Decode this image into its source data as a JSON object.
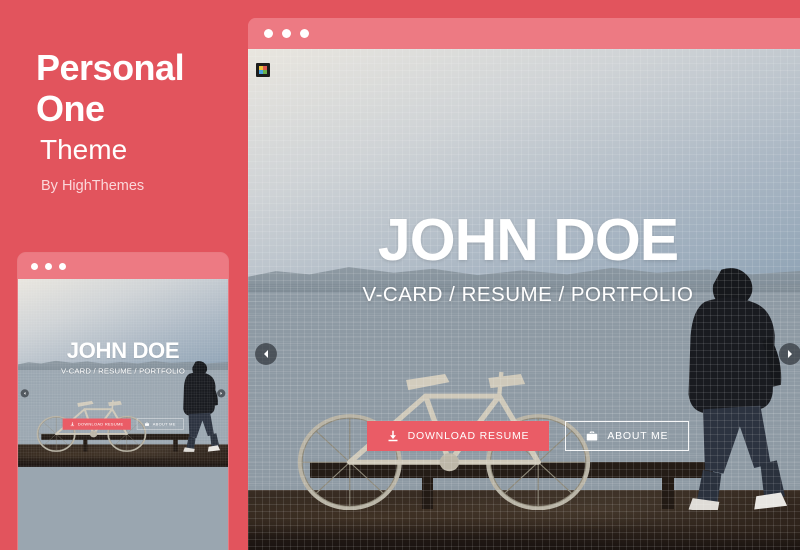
{
  "page": {
    "background_color": "#e2545d",
    "chrome_color": "#ed7a83"
  },
  "left_panel": {
    "title": "Personal One",
    "subtitle": "Theme",
    "author": "By HighThemes"
  },
  "browser_window": {
    "name": "main-browser-preview",
    "dots": [
      "dot-1",
      "dot-2",
      "dot-3"
    ]
  },
  "mobile_window": {
    "name": "mobile-browser-preview",
    "dots": [
      "dot-1",
      "dot-2",
      "dot-3"
    ]
  },
  "hero": {
    "logo_icon": "site-logo-icon",
    "title": "JOHN DOE",
    "subtitle": "V-CARD / RESUME / PORTFOLIO",
    "buttons": [
      {
        "label": "DOWNLOAD RESUME",
        "icon": "download-icon",
        "style": "primary",
        "color": "#ea5c66"
      },
      {
        "label": "ABOUT ME",
        "icon": "briefcase-icon",
        "style": "outline",
        "color": "#ffffff"
      }
    ],
    "nav": {
      "prev_icon": "chevron-left-icon",
      "next_icon": "chevron-right-icon"
    },
    "scene_description": "bicycle leaning on bench at waterfront pier with walking man silhouette"
  }
}
